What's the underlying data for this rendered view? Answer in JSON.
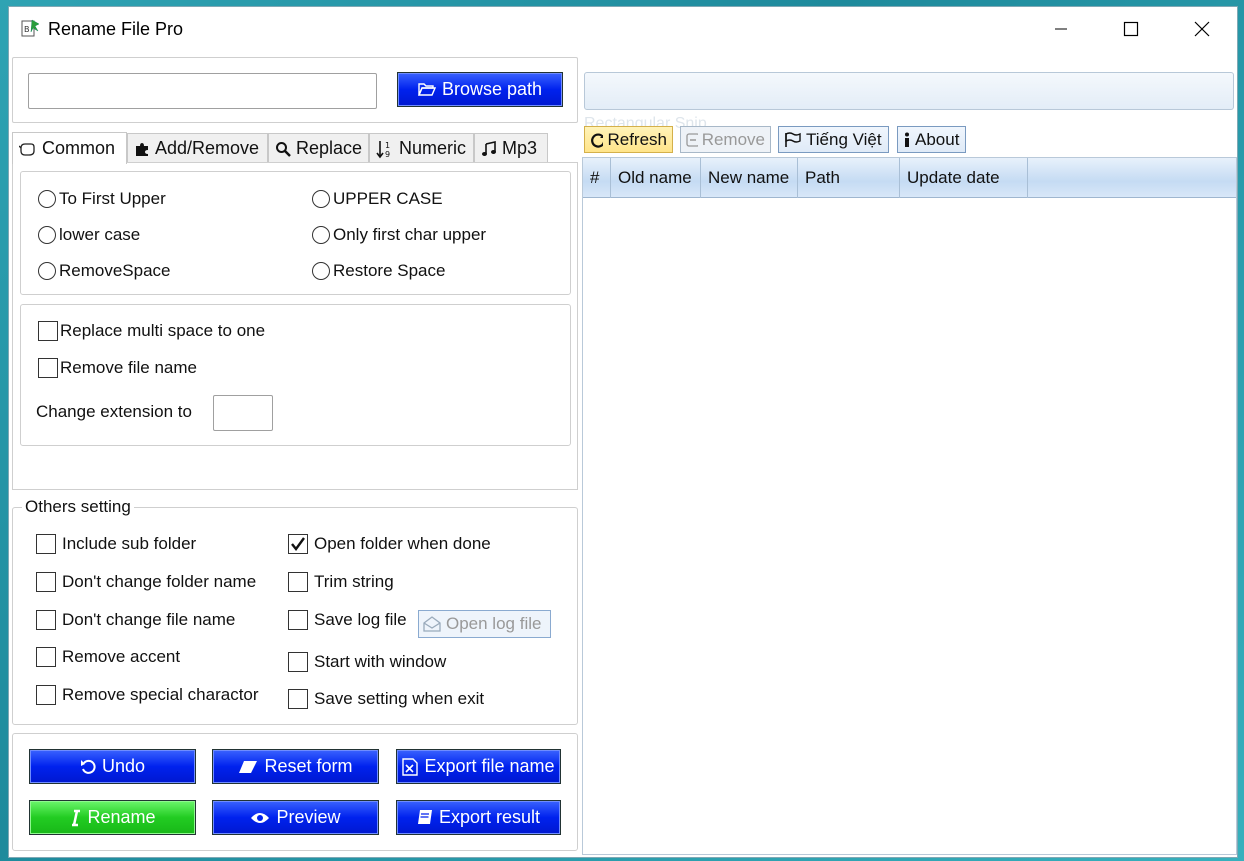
{
  "window": {
    "title": "Rename File Pro",
    "icons": [
      "app-icon",
      "minimize-icon",
      "maximize-icon",
      "close-icon"
    ]
  },
  "path": {
    "input_value": "",
    "browse_label": "Browse path",
    "browse_icon": "folder-open-icon"
  },
  "tabs": [
    {
      "label": "Common",
      "icon": "hand-icon",
      "active": true
    },
    {
      "label": "Add/Remove",
      "icon": "puzzle-icon"
    },
    {
      "label": "Replace",
      "icon": "search-icon"
    },
    {
      "label": "Numeric",
      "icon": "sort-numeric-icon"
    },
    {
      "label": "Mp3",
      "icon": "music-icon"
    }
  ],
  "case_options": {
    "to_first_upper": "To First Upper",
    "upper_case": "UPPER CASE",
    "lower_case": "lower case",
    "only_first_char_upper": "Only first char upper",
    "remove_space": "RemoveSpace",
    "restore_space": "Restore Space"
  },
  "common_options": {
    "replace_multi_space": "Replace multi space to one",
    "remove_file_name": "Remove file name",
    "change_extension_label": "Change extension to",
    "change_extension_value": ""
  },
  "others": {
    "legend": "Others setting",
    "include_sub_folder": "Include sub folder",
    "dont_change_folder": "Don't change folder name",
    "dont_change_file": "Don't change file name",
    "remove_accent": "Remove accent",
    "remove_special": "Remove special charactor",
    "open_folder_when_done": "Open folder when done",
    "trim_string": "Trim string",
    "save_log_file": "Save log file",
    "open_log_file": "Open log file",
    "start_with_window": "Start with window",
    "save_setting_on_exit": "Save setting when exit",
    "checked": [
      "open_folder_when_done"
    ]
  },
  "actions": {
    "undo": "Undo",
    "reset_form": "Reset form",
    "export_file_name": "Export file name",
    "rename": "Rename",
    "preview": "Preview",
    "export_result": "Export result",
    "colors": {
      "blue": "#0022ee",
      "green": "#22cc22"
    }
  },
  "toolbar": {
    "refresh": "Refresh",
    "remove": "Remove",
    "language": "Tiếng Việt",
    "about": "About"
  },
  "grid": {
    "columns": [
      "#",
      "Old name",
      "New name",
      "Path",
      "Update date"
    ],
    "rows": []
  },
  "ghost_text": "Rectangular Snip"
}
